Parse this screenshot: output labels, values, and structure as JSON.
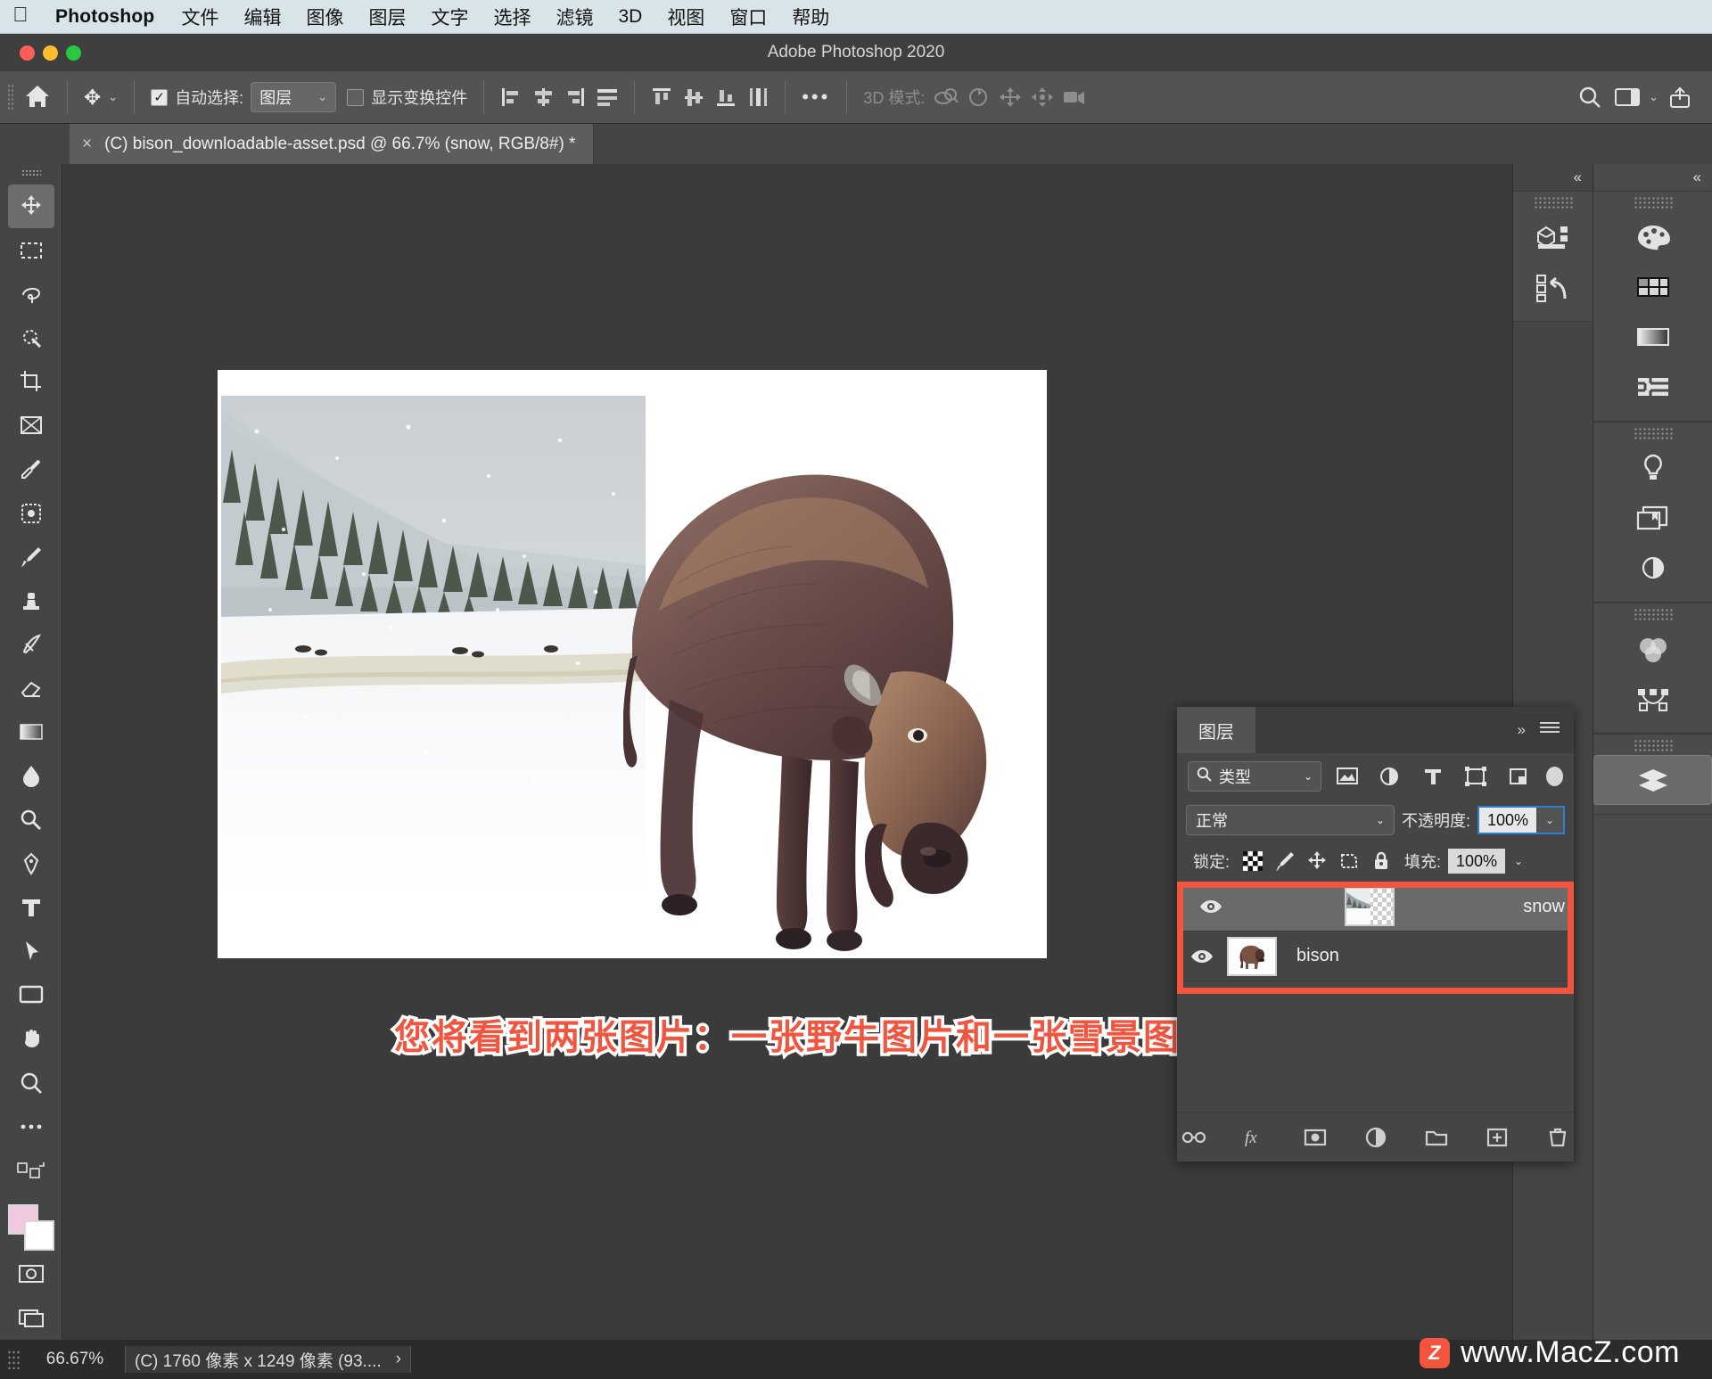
{
  "mac_menu": {
    "apple_icon": "apple-icon",
    "app_name": "Photoshop",
    "items": [
      "文件",
      "编辑",
      "图像",
      "图层",
      "文字",
      "选择",
      "滤镜",
      "3D",
      "视图",
      "窗口",
      "帮助"
    ]
  },
  "window": {
    "title": "Adobe Photoshop 2020"
  },
  "options_bar": {
    "home_icon": "home-icon",
    "tool_icon": "move-tool-icon",
    "tool_caret": "⌄",
    "auto_select_checked": true,
    "auto_select_label": "自动选择:",
    "auto_select_value": "图层",
    "auto_select_caret": "⌄",
    "show_transform_checked": false,
    "show_transform_label": "显示变换控件",
    "more_dots": "•••",
    "mode_3d_label": "3D 模式:",
    "align_icons": [
      "align-left-icon",
      "align-center-h-icon",
      "align-right-icon",
      "distribute-h-icon",
      "align-top-icon",
      "align-center-v-icon",
      "align-bottom-icon",
      "distribute-v-icon"
    ],
    "mode_3d_icons": [
      "orbit-3d-icon",
      "roll-3d-icon",
      "pan-3d-icon",
      "slide-3d-icon",
      "camera-3d-icon"
    ],
    "right_icons": [
      "search-icon",
      "workspace-icon",
      "chevron-down-icon",
      "share-icon"
    ]
  },
  "document_tab": {
    "close_icon": "×",
    "title": "(C) bison_downloadable-asset.psd @ 66.7% (snow, RGB/8#) *"
  },
  "toolbar": {
    "tools": [
      {
        "name": "move-tool",
        "active": true
      },
      {
        "name": "marquee-tool",
        "active": false
      },
      {
        "name": "lasso-tool",
        "active": false
      },
      {
        "name": "quick-select-tool",
        "active": false
      },
      {
        "name": "crop-tool",
        "active": false
      },
      {
        "name": "frame-tool",
        "active": false
      },
      {
        "name": "eyedropper-tool",
        "active": false
      },
      {
        "name": "healing-brush-tool",
        "active": false
      },
      {
        "name": "brush-tool",
        "active": false
      },
      {
        "name": "clone-stamp-tool",
        "active": false
      },
      {
        "name": "history-brush-tool",
        "active": false
      },
      {
        "name": "eraser-tool",
        "active": false
      },
      {
        "name": "gradient-tool",
        "active": false
      },
      {
        "name": "blur-tool",
        "active": false
      },
      {
        "name": "dodge-tool",
        "active": false
      },
      {
        "name": "pen-tool",
        "active": false
      },
      {
        "name": "type-tool",
        "active": false
      },
      {
        "name": "path-select-tool",
        "active": false
      },
      {
        "name": "rectangle-tool",
        "active": false
      },
      {
        "name": "hand-tool",
        "active": false
      },
      {
        "name": "zoom-tool",
        "active": false
      },
      {
        "name": "more-tools",
        "active": false
      }
    ],
    "foreground_color": "#f0c8e0",
    "background_color": "#ffffff",
    "quick-mask-icon": "quick-mask-icon",
    "screen-mode-icon": "screen-mode-icon"
  },
  "canvas": {
    "caption": "您将看到两张图片：一张野牛图片和一张雪景图",
    "caption_color": "#f0553f",
    "caption_stroke": "#ffffff"
  },
  "dock_left": {
    "collapse_icon": "«",
    "groups": [
      {
        "icons": [
          "3d-panel-icon",
          "history-panel-icon"
        ]
      }
    ]
  },
  "dock_right": {
    "collapse_icon": "«",
    "groups": [
      {
        "icons": [
          "color-panel-icon",
          "swatches-panel-icon",
          "gradients-panel-icon",
          "patterns-panel-icon"
        ]
      },
      {
        "icons": [
          "adjustments-panel-icon",
          "libraries-panel-icon",
          "properties-panel-icon"
        ]
      },
      {
        "icons": [
          "channels-panel-icon",
          "paths-panel-icon"
        ]
      },
      {
        "icons": [
          "layers-panel-icon"
        ]
      }
    ]
  },
  "layers_panel": {
    "tab_label": "图层",
    "expand_icon": "»",
    "menu_icon": "panel-menu-icon",
    "filter": {
      "search_icon": "search-icon",
      "kind_label": "类型",
      "caret": "⌄",
      "filter_icons": [
        "filter-pixel-icon",
        "filter-adjustment-icon",
        "filter-type-icon",
        "filter-shape-icon",
        "filter-smart-icon"
      ],
      "toggle_on": true
    },
    "blend_mode": "正常",
    "blend_caret": "⌄",
    "opacity_label": "不透明度:",
    "opacity_value": "100%",
    "opacity_caret": "⌄",
    "lock_label": "锁定:",
    "lock_icons": [
      "lock-transparent-icon",
      "lock-image-icon",
      "lock-position-icon",
      "lock-artboard-icon",
      "lock-all-icon"
    ],
    "fill_label": "填充:",
    "fill_value": "100%",
    "fill_caret": "⌄",
    "highlight_color": "#f2543d",
    "layers": [
      {
        "name": "snow",
        "visible": true,
        "selected": true,
        "thumb": "snow-thumb",
        "eye_icon": "eye-icon"
      },
      {
        "name": "bison",
        "visible": true,
        "selected": false,
        "thumb": "bison-thumb",
        "eye_icon": "eye-icon"
      }
    ],
    "bottom_icons": [
      "link-layers-icon",
      "fx-icon",
      "add-mask-icon",
      "adjustment-layer-icon",
      "new-group-icon",
      "new-layer-icon",
      "delete-layer-icon"
    ]
  },
  "status_bar": {
    "zoom": "66.67%",
    "doc_info": "(C) 1760 像素 x 1249 像素 (93....",
    "doc_caret": "›"
  },
  "watermark": {
    "badge": "Z",
    "text": "www.MacZ.com"
  }
}
